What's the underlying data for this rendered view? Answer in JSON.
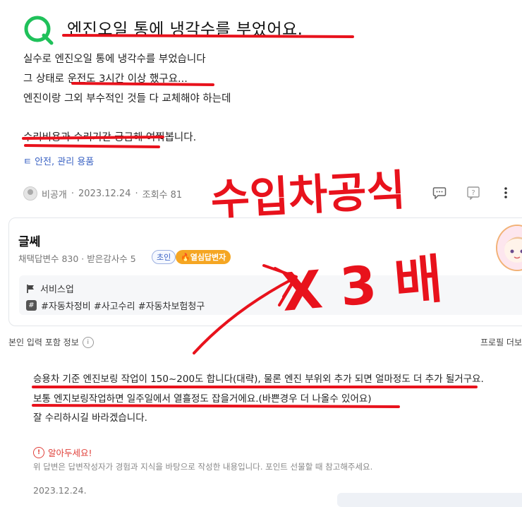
{
  "question": {
    "title": "엔진오일 통에 냉각수를 부었어요.",
    "lines": [
      "실수로 엔진오일 통에 냉각수를 부었습니다",
      "그 상태로 운전도 3시간 이상 했구요...",
      "엔진이랑 그외 부수적인 것들 다 교체해야 하는데",
      "수리비용과 수리기간 궁금해 여쭤봅니다."
    ],
    "category": "ㅌ 안전, 관리 용품",
    "author": "비공개",
    "date": "2023.12.24",
    "views": "조회수 81"
  },
  "answer": {
    "name": "글쎄",
    "stats": "채택답변수 830 · 받은감사수 5",
    "badge_beginner": "초인",
    "badge_hot": "🔥열심답변자",
    "service": "서비스업",
    "tags": "#자동차정비 #사고수리 #자동차보험청구",
    "info_left": "본인 입력 포함 정보",
    "info_right": "프로필 더보",
    "lines": [
      "승용차 기준 엔진보링 작업이 150~200도 합니다(대략), 물론 엔진 부위외 추가 되면 얼마정도 더 추가 될거구요.",
      "보통 엔지보링작업하면 일주일에서 열흘정도 잡을거에요.(바쁜경우 더 나올수 있어요)",
      "잘 수리하시길 바라겠습니다."
    ],
    "warning_title": "알아두세요!",
    "warning_text": "위 답변은 답변작성자가 경험과 지식을 바탕으로 작성한 내용입니다. 포인트 선물할 때 참고해주세요.",
    "date": "2023.12.24."
  },
  "handwriting": {
    "line1": "수입차공식",
    "line2": "X 3 배"
  },
  "colors": {
    "q_green": "#1fc15a",
    "ink_red": "#e8121c",
    "badge_orange": "#f5a623",
    "link_blue": "#3b63c4"
  }
}
